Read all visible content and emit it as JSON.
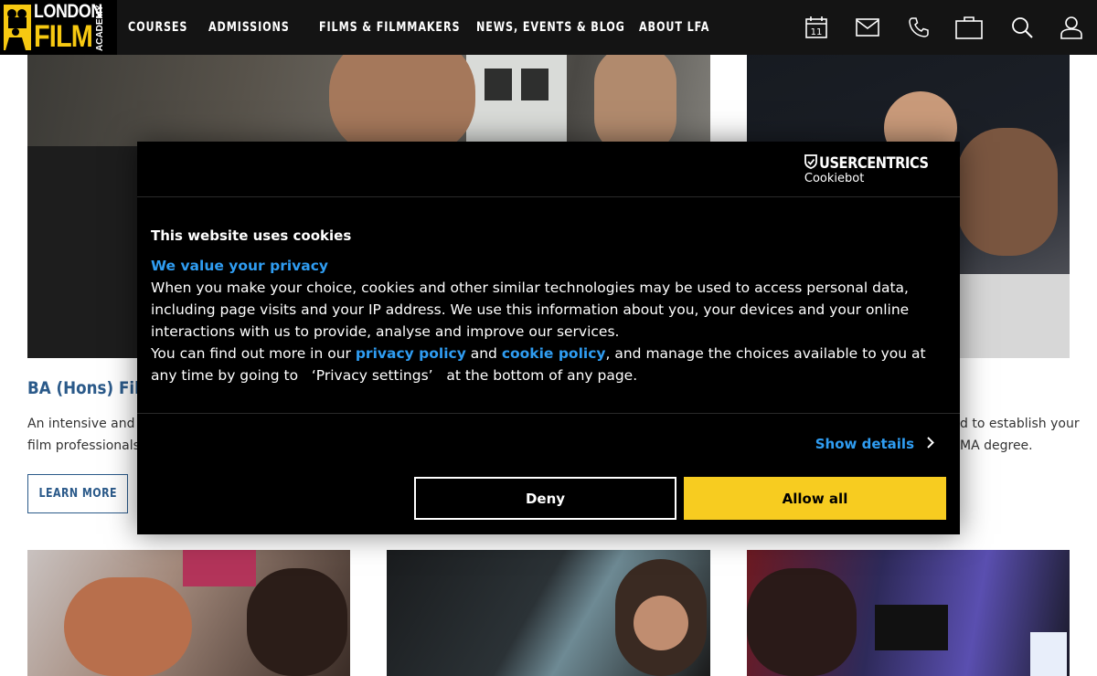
{
  "header": {
    "logo": {
      "line1": "LONDON",
      "line2": "FILM",
      "line3": "ACADEMY"
    },
    "nav": [
      "COURSES",
      "ADMISSIONS",
      "FILMS & FILMMAKERS",
      "NEWS, EVENTS & BLOG",
      "ABOUT LFA"
    ],
    "icons": [
      "calendar-icon",
      "mail-icon",
      "phone-icon",
      "bag-icon",
      "search-icon",
      "user-icon"
    ],
    "calendar_day": "11"
  },
  "cards": {
    "title_partial": "BA (Hons) Film",
    "left_text": [
      "An intensive and p",
      "film professionals"
    ],
    "right_text": [
      "d to establish your",
      "MA degree."
    ],
    "learn_more": "LEARN MORE"
  },
  "cookie": {
    "brand": "USERCENTRICS",
    "brand_sub": "Cookiebot",
    "title": "This website uses cookies",
    "subtitle": "We value your privacy",
    "para1": "When you make your choice, cookies and other similar technologies may be used to access personal data, including page visits and your IP address. We use this information about you, your devices and your online interactions with us to provide, analyse and improve our services.",
    "para2_start": "You can find out more in our ",
    "privacy_link": "privacy policy",
    "para2_and": " and ",
    "cookie_link": "cookie policy",
    "para2_end": ", and manage the choices available to you at any time by going to   ‘Privacy settings’   at the bottom of any page.",
    "show_details": "Show details",
    "deny": "Deny",
    "allow_all": "Allow all"
  },
  "colors": {
    "accent_blue": "#2f9df2",
    "allow_yellow": "#f7cc20",
    "brand_yellow": "#f7c911",
    "link_navy": "#2b5a8a"
  }
}
